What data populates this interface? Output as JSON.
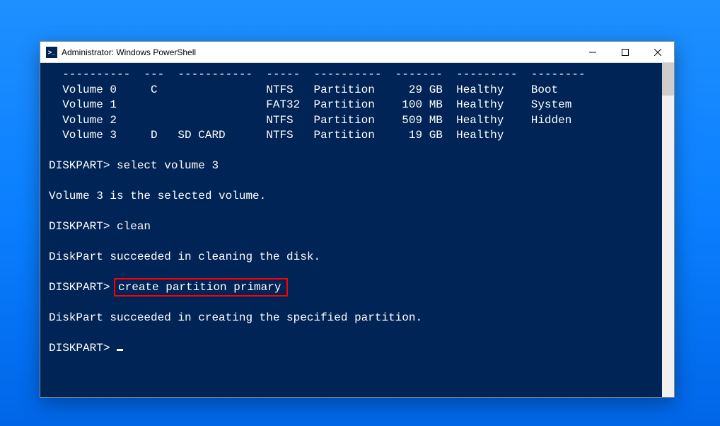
{
  "window": {
    "title": "Administrator: Windows PowerShell",
    "icon_label": ">_"
  },
  "terminal": {
    "divider": "  ----------  ---  -----------  -----  ----------  -------  ---------  --------",
    "volumes": [
      {
        "line": "  Volume 0     C                NTFS   Partition     29 GB  Healthy    Boot"
      },
      {
        "line": "  Volume 1                      FAT32  Partition    100 MB  Healthy    System"
      },
      {
        "line": "  Volume 2                      NTFS   Partition    509 MB  Healthy    Hidden"
      },
      {
        "line": "  Volume 3     D   SD CARD      NTFS   Partition     19 GB  Healthy"
      }
    ],
    "prompt1_label": "DISKPART> ",
    "cmd1": "select volume 3",
    "out1": "Volume 3 is the selected volume.",
    "prompt2_label": "DISKPART> ",
    "cmd2": "clean",
    "out2": "DiskPart succeeded in cleaning the disk.",
    "prompt3_label": "DISKPART> ",
    "cmd3": "create partition primary",
    "out3": "DiskPart succeeded in creating the specified partition.",
    "prompt4_label": "DISKPART> "
  }
}
